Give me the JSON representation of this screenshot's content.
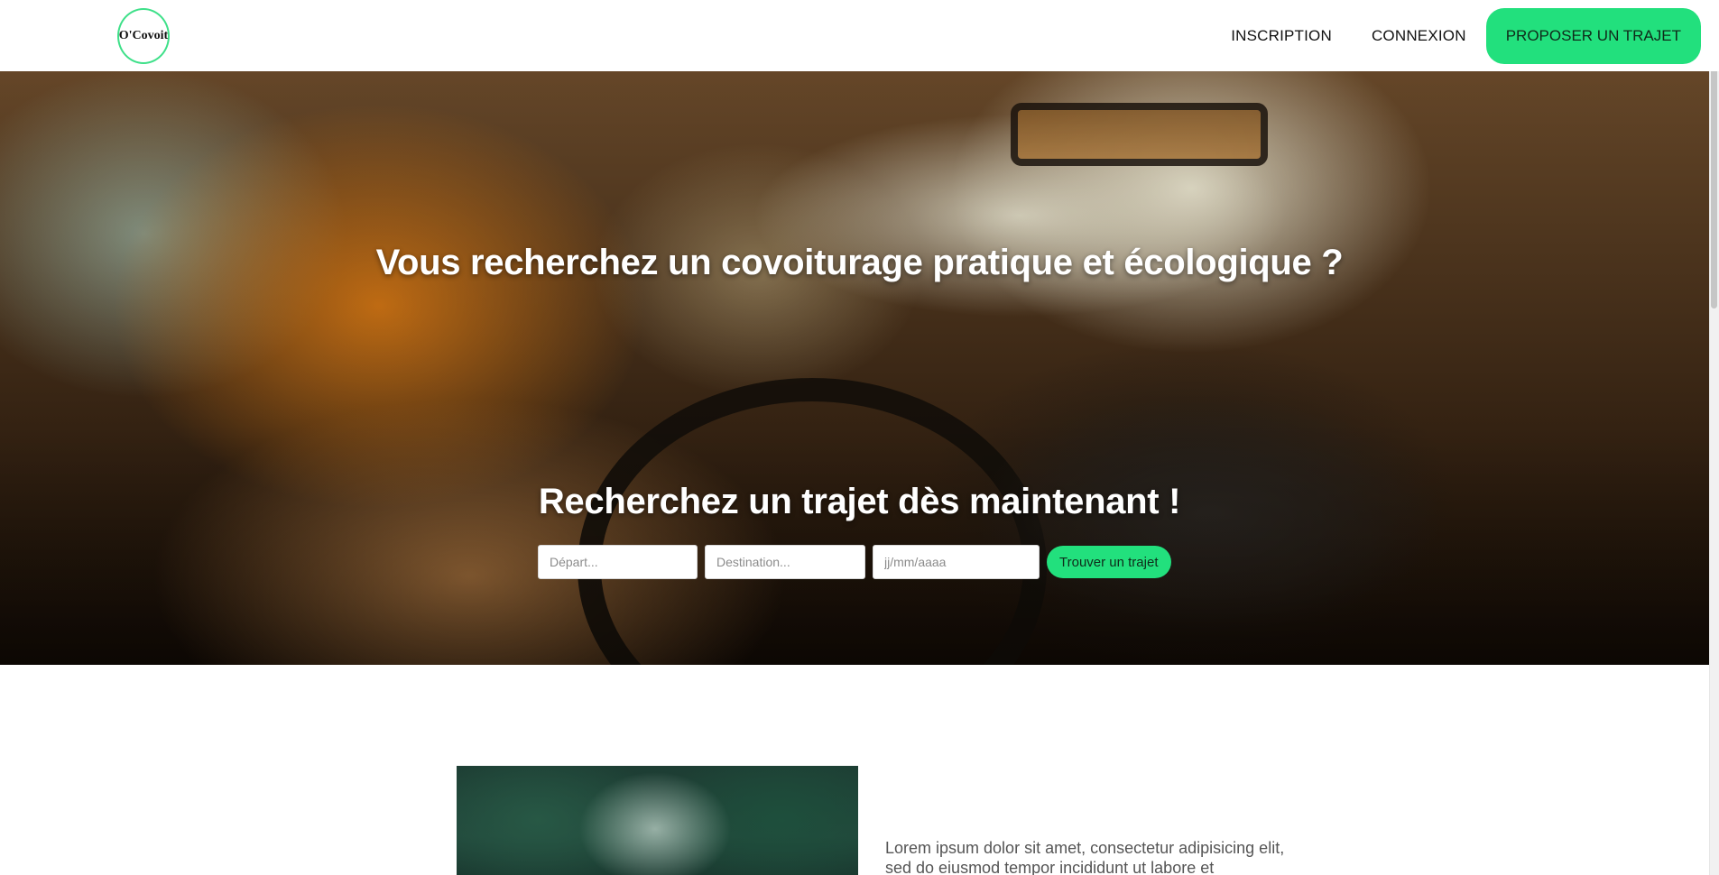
{
  "header": {
    "logo_text": "O'Covoit",
    "nav": {
      "inscription": "INSCRIPTION",
      "connexion": "CONNEXION",
      "proposer": "PROPOSER UN TRAJET"
    }
  },
  "hero": {
    "title": "Vous recherchez un covoiturage pratique et écologique ?",
    "subtitle": "Recherchez un trajet dès maintenant !",
    "search": {
      "depart_placeholder": "Départ...",
      "destination_placeholder": "Destination...",
      "date_placeholder": "jj/mm/aaaa",
      "button": "Trouver un trajet"
    }
  },
  "content": {
    "text": "Lorem ipsum dolor sit amet, consectetur adipisicing elit, sed do eiusmod tempor incididunt ut labore et"
  },
  "colors": {
    "accent": "#22e07d",
    "accent_border": "#3ee089",
    "text_dark": "#111111"
  }
}
